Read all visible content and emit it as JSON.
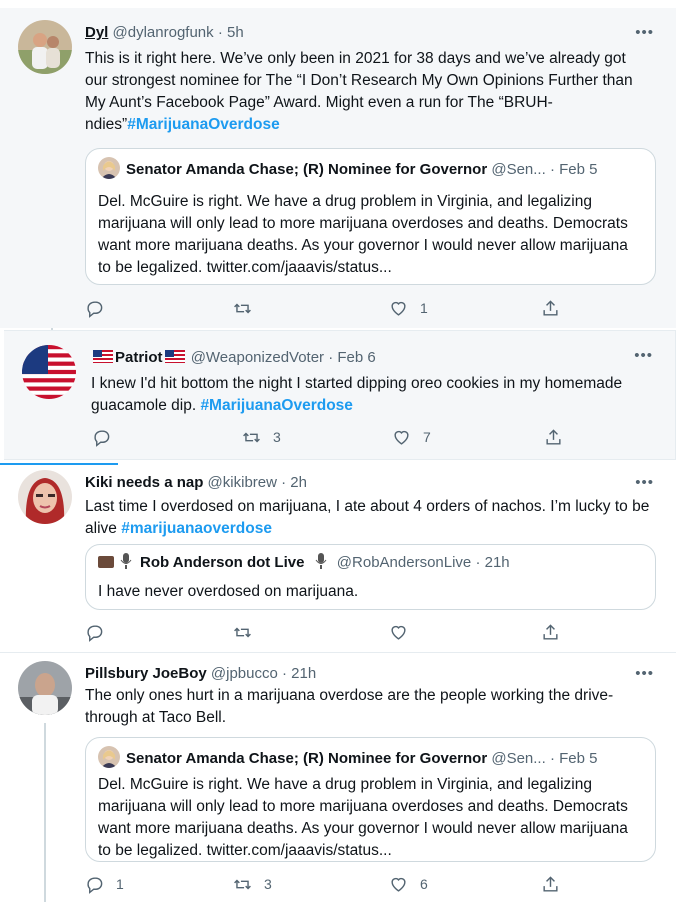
{
  "tweets": [
    {
      "name": "Dyl",
      "handle": "@dylanrogfunk",
      "time": "· 5h",
      "text": "This is it right here. We’ve only been in 2021 for 38 days and we’ve already got our strongest nominee for The “I Don’t Research My Own Opinions Further than My Aunt’s Facebook Page” Award. Might even a run for The “BRUH-ndies”",
      "hashtag": "#MarijuanaOverdose",
      "quote": {
        "name": "Senator Amanda Chase; (R) Nominee for Governor",
        "handle": "@Sen...",
        "time": "· Feb 5",
        "text": "Del. McGuire is right. We have a drug problem in Virginia, and legalizing marijuana will only lead to more marijuana overdoses and deaths. Democrats want more marijuana deaths. As your governor I would never allow marijuana to be legalized. twitter.com/jaaavis/status..."
      },
      "replies": "",
      "retweets": "",
      "likes": "1"
    },
    {
      "name": "Patriot",
      "handle": "@WeaponizedVoter",
      "time": "· Feb 6",
      "text": "I knew I'd hit bottom the night I started dipping oreo cookies in my homemade guacamole dip.",
      "hashtag": "#MarijuanaOverdose",
      "replies": "",
      "retweets": "3",
      "likes": "7"
    },
    {
      "name": "Kiki needs a nap",
      "handle": "@kikibrew",
      "time": "· 2h",
      "text": "Last time I overdosed on marijuana, I ate about 4 orders of nachos. I’m lucky to be alive",
      "hashtag": "#marijuanaoverdose",
      "quote": {
        "name": "Rob Anderson dot Live",
        "handle": "@RobAndersonLive",
        "time": "· 21h",
        "text": "I have never overdosed on marijuana."
      },
      "replies": "",
      "retweets": "",
      "likes": ""
    },
    {
      "name": "Pillsbury JoeBoy",
      "handle": "@jpbucco",
      "time": "· 21h",
      "text": "The only ones hurt in a marijuana overdose are the people working the drive-through at Taco Bell.",
      "quote": {
        "name": "Senator Amanda Chase; (R) Nominee for Governor",
        "handle": "@Sen...",
        "time": "· Feb 5",
        "text": "Del. McGuire is right. We have a drug problem in Virginia, and legalizing marijuana will only lead to more marijuana overdoses and deaths. Democrats want more marijuana deaths. As your governor I would never allow marijuana to be legalized. twitter.com/jaaavis/status..."
      },
      "replies": "1",
      "retweets": "3",
      "likes": "6"
    }
  ],
  "more_label": "•••",
  "icons": [
    "reply-icon",
    "retweet-icon",
    "like-icon",
    "share-icon",
    "more-icon",
    "us-flag-icon",
    "microphone-icon"
  ],
  "colors": {
    "link": "#1d9bf0",
    "muted": "#536471",
    "border": "#cfd9de",
    "gray_bg": "#f5f7f9"
  }
}
